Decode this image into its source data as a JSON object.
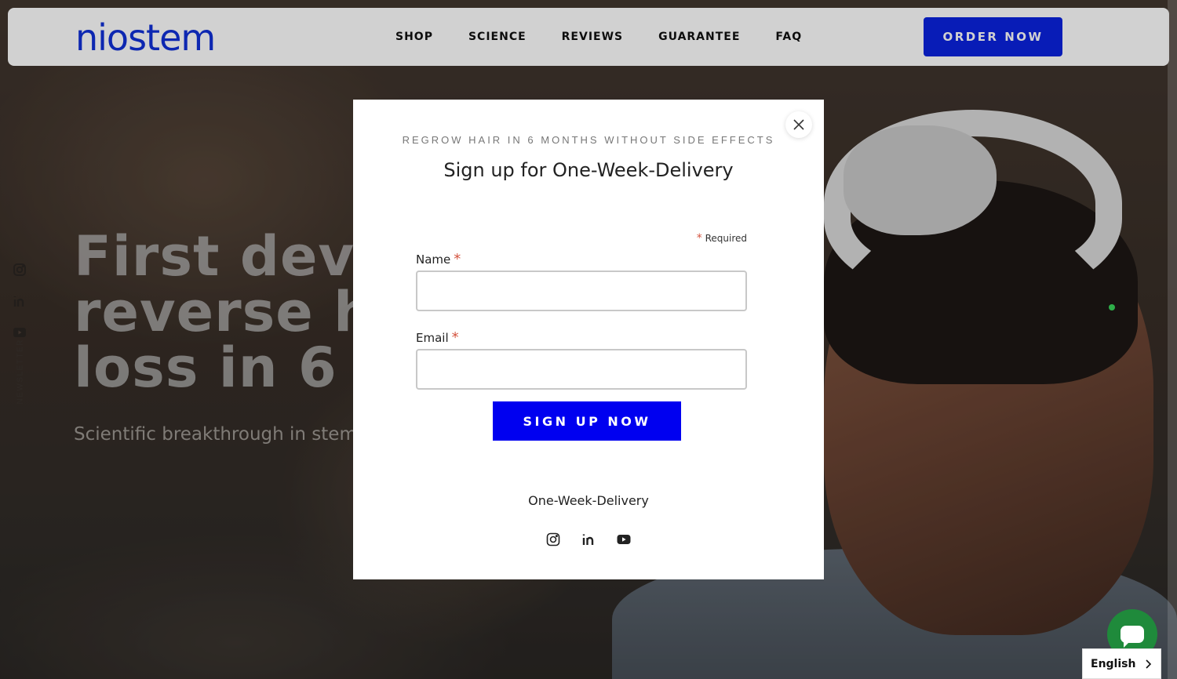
{
  "header": {
    "logo": "niostem",
    "nav": [
      "SHOP",
      "SCIENCE",
      "REVIEWS",
      "GUARANTEE",
      "FAQ"
    ],
    "order_label": "ORDER NOW"
  },
  "hero": {
    "title": "First devi\nreverse h\nloss in 6 m",
    "subtitle": "Scientific breakthrough in stem"
  },
  "left_rail": {
    "icons": [
      "instagram-icon",
      "linkedin-icon",
      "youtube-icon"
    ],
    "newsletter_label": "NEWSLETTER"
  },
  "modal": {
    "eyebrow": "REGROW HAIR IN 6 MONTHS WITHOUT SIDE EFFECTS",
    "title": "Sign up for One-Week-Delivery",
    "required_star": "*",
    "required_label": "Required",
    "name_label": "Name",
    "name_value": "",
    "email_label": "Email",
    "email_value": "",
    "signup_label": "SIGN UP NOW",
    "brand_line": "One-Week-Delivery",
    "social_icons": [
      "instagram-icon",
      "linkedin-icon",
      "youtube-icon"
    ]
  },
  "language": {
    "selected": "English"
  },
  "colors": {
    "brand_blue": "#1030d8",
    "button_blue": "#0a23e0",
    "required_red": "#d4543f",
    "chat_green": "#1f8a3b"
  }
}
